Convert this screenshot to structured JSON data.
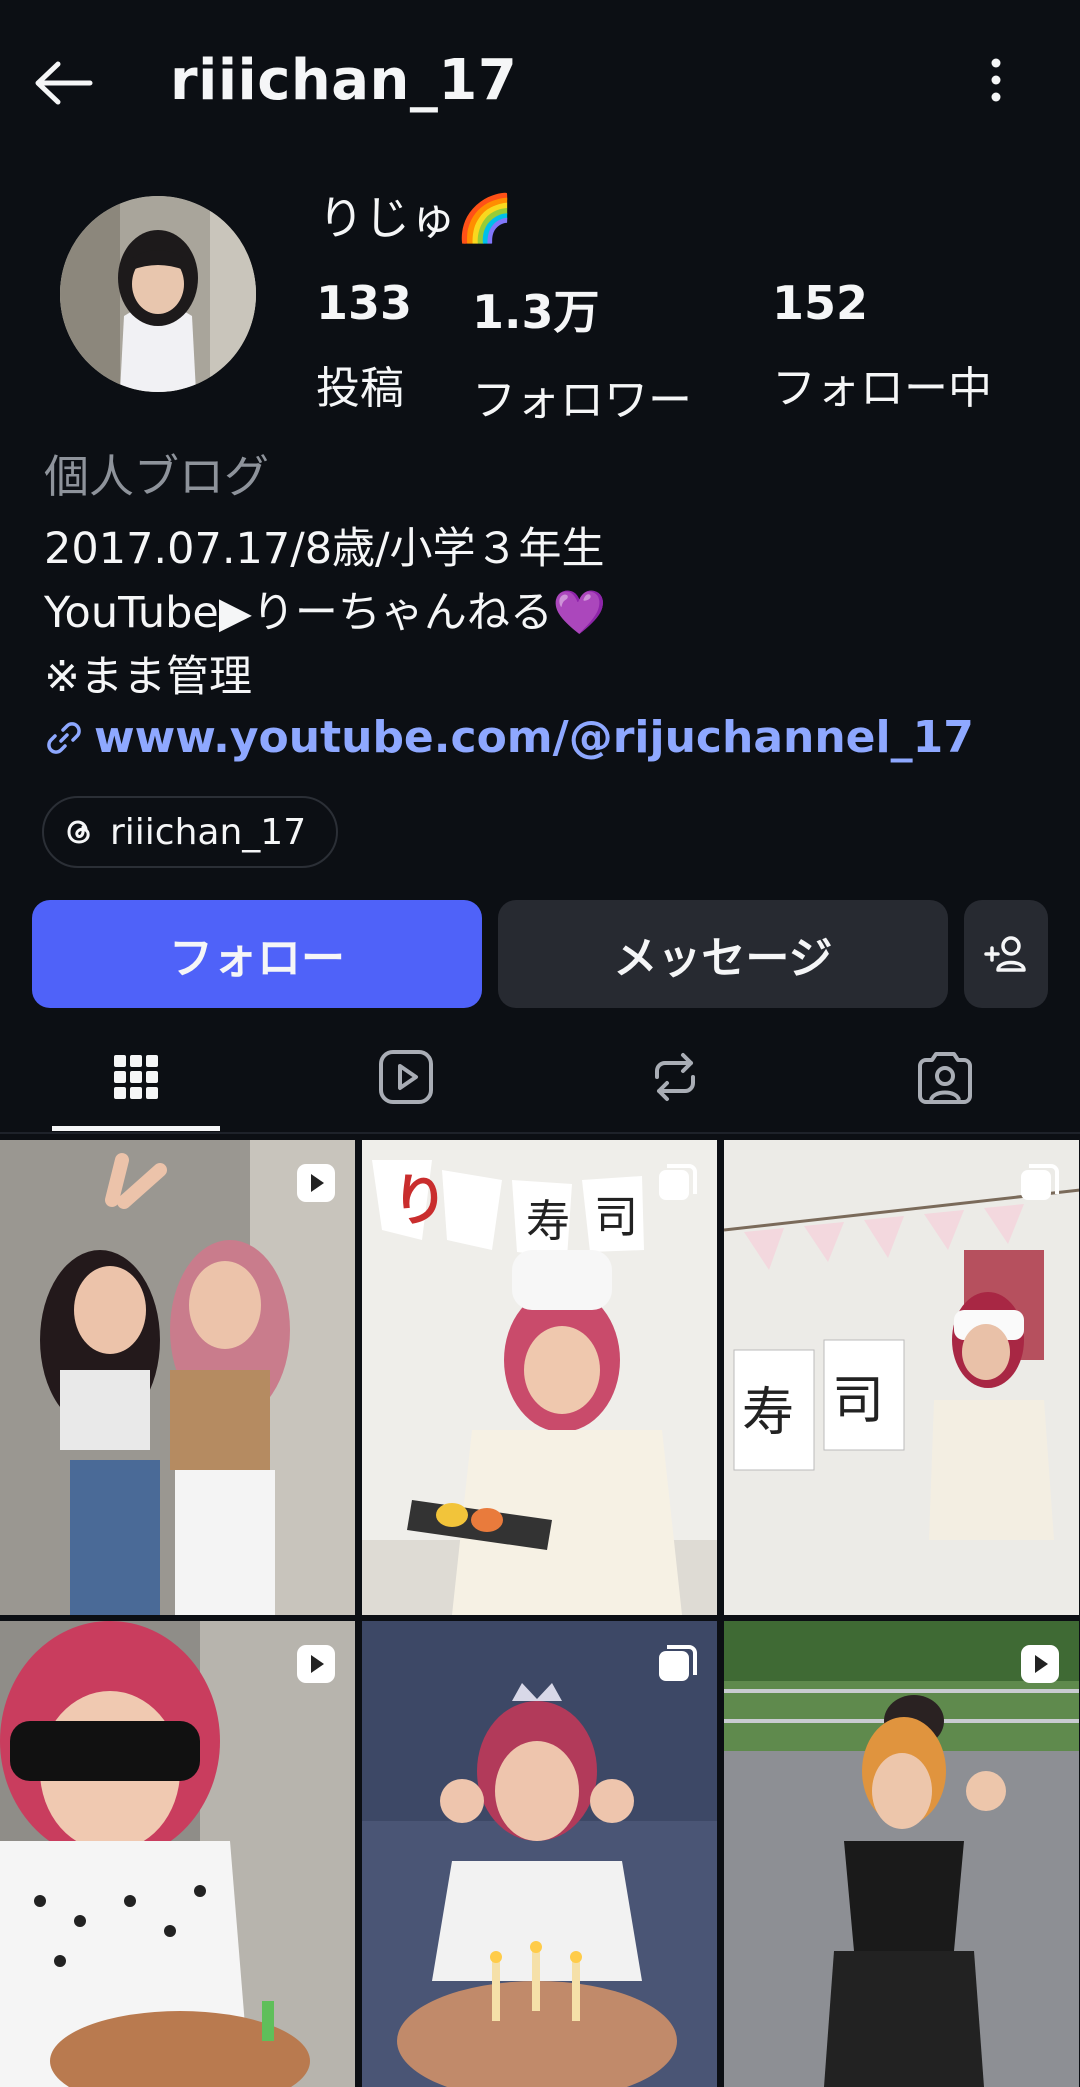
{
  "header": {
    "username": "riiichan_17",
    "back_icon": "arrow-left-icon",
    "more_icon": "kebab-menu-icon"
  },
  "profile": {
    "display_name": "りじゅ🌈",
    "stats": [
      {
        "value": "133",
        "label": "投稿"
      },
      {
        "value": "1.3万",
        "label": "フォロワー"
      },
      {
        "value": "152",
        "label": "フォロー中"
      }
    ]
  },
  "bio": {
    "category": "個人ブログ",
    "lines": [
      "2017.07.17/8歳/小学３年生",
      "YouTube▶りーちゃんねる💜",
      "※まま管理"
    ],
    "link": "www.youtube.com/@rijuchannel_17"
  },
  "threads": {
    "handle": "riiichan_17",
    "icon": "threads-icon"
  },
  "actions": {
    "follow_label": "フォロー",
    "message_label": "メッセージ",
    "add_icon": "add-person-icon"
  },
  "tabs": [
    {
      "icon": "grid-icon",
      "active": true
    },
    {
      "icon": "reels-icon",
      "active": false
    },
    {
      "icon": "repost-icon",
      "active": false
    },
    {
      "icon": "tagged-icon",
      "active": false
    }
  ],
  "posts": [
    {
      "badge": "reel-icon"
    },
    {
      "badge": "carousel-icon"
    },
    {
      "badge": "carousel-icon"
    },
    {
      "badge": "reel-icon"
    },
    {
      "badge": "carousel-icon"
    },
    {
      "badge": "reel-icon"
    }
  ],
  "colors": {
    "background": "#0c0f14",
    "follow_button": "#4f62f9",
    "secondary_button": "#272a31",
    "link": "#8ea8ff"
  }
}
